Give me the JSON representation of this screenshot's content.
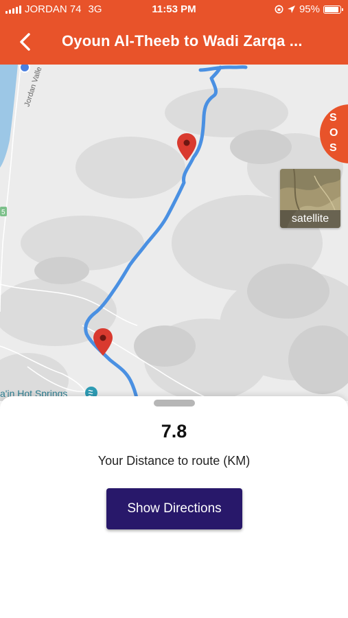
{
  "status_bar": {
    "carrier": "JORDAN 74",
    "network": "3G",
    "time": "11:53 PM",
    "battery_percent": "95%",
    "battery_level": 0.95
  },
  "header": {
    "title": "Oyoun Al-Theeb to Wadi Zarqa ..."
  },
  "map": {
    "labels": {
      "road": "Jordan Valle",
      "marker_five": "5",
      "poi": "a'in Hot Springs"
    },
    "route_color": "#4a90e2",
    "marker_color": "#d93a2f",
    "sos_letters": [
      "S",
      "O",
      "S"
    ],
    "satellite_label": "satellite"
  },
  "sheet": {
    "distance_value": "7.8",
    "distance_label": "Your Distance to route  (KM)",
    "directions_button": "Show Directions"
  },
  "colors": {
    "accent": "#e8532a",
    "button": "#28186a"
  }
}
